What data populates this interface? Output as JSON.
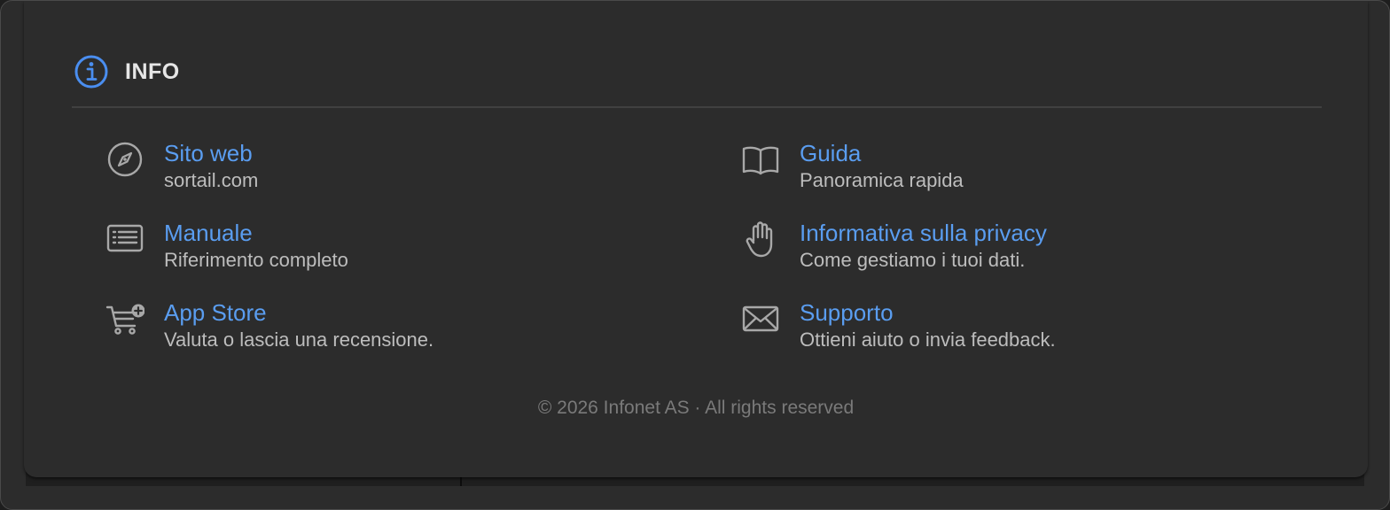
{
  "header": {
    "title": "INFO",
    "icon": "info-circle-icon",
    "accent_color": "#4a8ef0"
  },
  "items": [
    {
      "icon": "compass-icon",
      "title": "Sito web",
      "subtitle": "sortail.com"
    },
    {
      "icon": "book-icon",
      "title": "Guida",
      "subtitle": "Panoramica rapida"
    },
    {
      "icon": "list-document-icon",
      "title": "Manuale",
      "subtitle": "Riferimento completo"
    },
    {
      "icon": "raised-hand-icon",
      "title": "Informativa sulla privacy",
      "subtitle": "Come gestiamo i tuoi dati."
    },
    {
      "icon": "cart-plus-icon",
      "title": "App Store",
      "subtitle": "Valuta o lascia una recensione."
    },
    {
      "icon": "envelope-icon",
      "title": "Supporto",
      "subtitle": "Ottieni aiuto o invia feedback."
    }
  ],
  "footer": {
    "text": "© 2026 Infonet AS · All rights reserved"
  },
  "colors": {
    "link": "#5a9df0",
    "subtitle": "#bdbdbd",
    "footer": "#7a7a7a",
    "background": "#2c2c2c"
  }
}
